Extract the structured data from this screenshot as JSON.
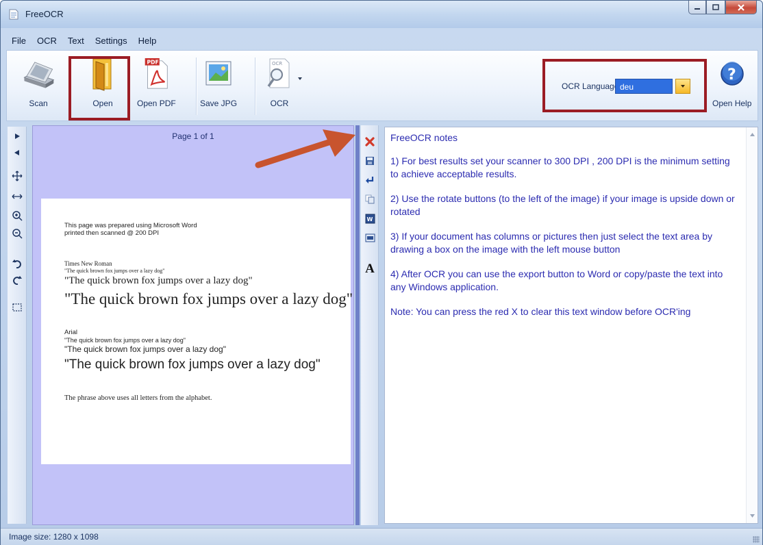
{
  "window": {
    "title": "FreeOCR"
  },
  "menu": [
    "File",
    "OCR",
    "Text",
    "Settings",
    "Help"
  ],
  "toolbar": {
    "scan_label": "Scan",
    "open_label": "Open",
    "open_pdf_label": "Open PDF",
    "open_pdf_badge": "PDF",
    "save_jpg_label": "Save JPG",
    "ocr_label": "OCR",
    "ocr_icon_text": "OCR",
    "ocr_language_label": "OCR Language:",
    "ocr_language_value": "deu",
    "open_help_label": "Open Help"
  },
  "image_panel": {
    "page_label": "Page 1 of 1",
    "document_lines": [
      "This page was prepared using Microsoft Word",
      "printed then scanned @ 200 DPI",
      "Times New Roman",
      "\"The quick brown fox jumps over a lazy dog\"",
      "\"The quick brown fox jumps over a lazy dog\"",
      "\"The quick brown fox jumps over a lazy dog\"",
      "Arial",
      "\"The quick brown fox jumps over a lazy dog\"",
      "\"The quick brown fox  jumps over a lazy dog\"",
      "\"The quick brown fox jumps over a lazy dog\"",
      "The phrase above uses all letters from the alphabet."
    ]
  },
  "text_output": {
    "paragraphs": [
      "FreeOCR notes",
      "1) For best results set your scanner to 300 DPI , 200 DPI is the minimum setting to achieve acceptable results.",
      "2) Use the rotate buttons (to the left of the image) if your image is upside down or rotated",
      "3) If your document has columns or pictures then just select the text area by drawing a box on the image with the left mouse button",
      "4) After OCR you can use the export button to Word or copy/paste the text into any Windows application.",
      "Note: You can press the red X to clear this text window before OCR'ing"
    ],
    "tools": [
      "clear-icon",
      "save-icon",
      "newline-icon",
      "copy-icon",
      "word-export-icon",
      "html-export-icon",
      "font-icon"
    ],
    "font_glyph": "A",
    "word_glyph": "W"
  },
  "status": {
    "image_size": "Image size: 1280 x 1098"
  },
  "colors": {
    "highlight": "#9b1c24",
    "arrow": "#c8542e",
    "image_bg": "#c2c2f8",
    "note_text": "#2b2bb0"
  }
}
